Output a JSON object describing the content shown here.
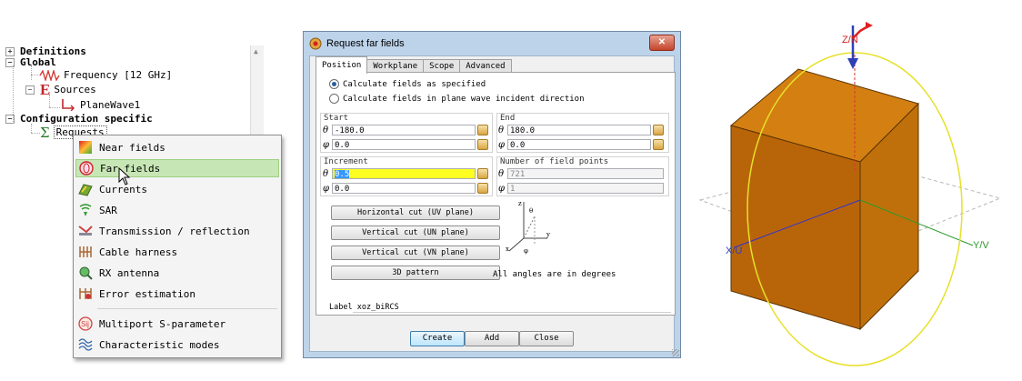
{
  "tree": {
    "definitions": "Definitions",
    "global": "Global",
    "frequency": "Frequency [12 GHz]",
    "sources": "Sources",
    "planewave": "PlaneWave1",
    "config": "Configuration specific",
    "requests": "Requests"
  },
  "menu": {
    "items": [
      {
        "label": "Near fields",
        "icon": "near-fields-icon"
      },
      {
        "label": "Far fields",
        "icon": "far-fields-icon"
      },
      {
        "label": "Currents",
        "icon": "currents-icon"
      },
      {
        "label": "SAR",
        "icon": "sar-icon"
      },
      {
        "label": "Transmission / reflection",
        "icon": "transmission-icon"
      },
      {
        "label": "Cable harness",
        "icon": "cable-harness-icon"
      },
      {
        "label": "RX antenna",
        "icon": "rx-antenna-icon"
      },
      {
        "label": "Error estimation",
        "icon": "error-estimation-icon"
      },
      {
        "label": "Multiport S-parameter",
        "icon": "s-parameter-icon"
      },
      {
        "label": "Characteristic modes",
        "icon": "characteristic-modes-icon"
      }
    ],
    "selected": "Far fields"
  },
  "dialog": {
    "title": "Request far fields",
    "close": "✕",
    "tabs": [
      "Position",
      "Workplane",
      "Scope",
      "Advanced"
    ],
    "active_tab": "Position",
    "radio_specified": "Calculate fields as specified",
    "radio_planewave": "Calculate fields in plane wave incident direction",
    "start_label": "Start",
    "end_label": "End",
    "increment_label": "Increment",
    "points_label": "Number of field points",
    "theta": "θ",
    "phi": "φ",
    "start_theta": "-180.0",
    "start_phi": "0.0",
    "end_theta": "180.0",
    "end_phi": "0.0",
    "inc_theta": "0.5",
    "inc_phi": "0.0",
    "points_theta": "721",
    "points_phi": "1",
    "btn_horizontal": "Horizontal cut (UV plane)",
    "btn_vertical_un": "Vertical cut (UN plane)",
    "btn_vertical_vn": "Vertical cut (VN plane)",
    "btn_3d": "3D pattern",
    "note": "All angles are in degrees",
    "label_prefix": "Label",
    "label_value": "xoz_biRCS",
    "create": "Create",
    "add": "Add",
    "close_btn": "Close"
  },
  "view3d": {
    "z_axis": "Z/N",
    "x_axis": "X/U",
    "y_axis": "Y/V",
    "cube_color": "#c0700a"
  }
}
